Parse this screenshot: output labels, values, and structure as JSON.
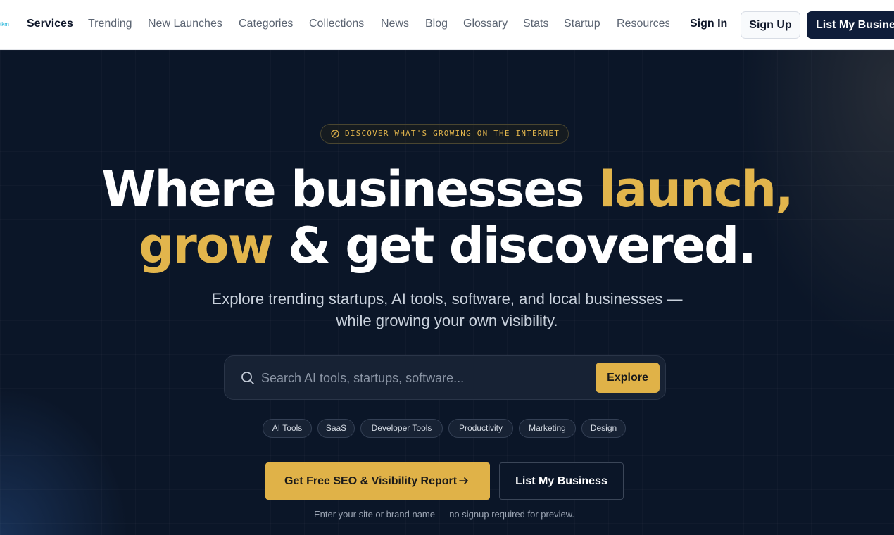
{
  "header": {
    "logo_fragment": "tkm",
    "nav": [
      "Services",
      "Trending",
      "New Launches",
      "Categories",
      "Collections",
      "News",
      "Blog",
      "Glossary",
      "Stats",
      "Startup",
      "Resources"
    ],
    "active_nav": "Services",
    "sign_in": "Sign In",
    "sign_up": "Sign Up",
    "list_business": "List My Business"
  },
  "hero": {
    "pill_icon": "compass-icon",
    "pill": "DISCOVER WHAT'S GROWING ON THE INTERNET",
    "headline": {
      "line1_white": "Where businesses ",
      "line1_accent": "launch,",
      "line2_accent": "grow",
      "line2_white": " & get discovered."
    },
    "subtitle_line1": "Explore trending startups, AI tools, software, and local businesses —",
    "subtitle_line2": "while growing your own visibility.",
    "search": {
      "icon": "search-icon",
      "placeholder": "Search AI tools, startups, software...",
      "button": "Explore"
    },
    "chips": [
      "AI Tools",
      "SaaS",
      "Developer Tools",
      "Productivity",
      "Marketing",
      "Design"
    ],
    "cta_primary": "Get Free SEO & Visibility Report",
    "cta_primary_icon": "arrow-right-icon",
    "cta_secondary": "List My Business",
    "note": "Enter your site or brand name — no signup required for preview."
  },
  "colors": {
    "accent": "#e0b248",
    "hero_bg": "#0b1628",
    "nav_bg": "#ffffff",
    "dark_button": "#0f1d3a"
  }
}
